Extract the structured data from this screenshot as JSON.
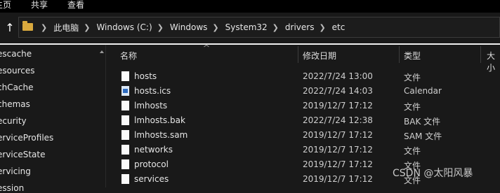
{
  "ribbon": {
    "tabs": [
      "主页",
      "共享",
      "查看"
    ]
  },
  "address": {
    "crumbs": [
      "此电脑",
      "Windows (C:)",
      "Windows",
      "System32",
      "drivers",
      "etc"
    ]
  },
  "nav": {
    "items": [
      "escache",
      "esources",
      "chCache",
      "chemas",
      "ecurity",
      "erviceProfiles",
      "erviceState",
      "ervicing",
      "ession"
    ]
  },
  "columns": {
    "name": "名称",
    "date": "修改日期",
    "type": "类型",
    "size": "大小"
  },
  "files": [
    {
      "name": "hosts",
      "date": "2022/7/24 13:00",
      "type": "文件",
      "icon": "file-icon"
    },
    {
      "name": "hosts.ics",
      "date": "2022/7/24 14:03",
      "type": "Calendar",
      "icon": "calendar-file-icon"
    },
    {
      "name": "lmhosts",
      "date": "2019/12/7 17:12",
      "type": "文件",
      "icon": "file-icon"
    },
    {
      "name": "lmhosts.bak",
      "date": "2022/7/24 12:38",
      "type": "BAK 文件",
      "icon": "file-icon"
    },
    {
      "name": "lmhosts.sam",
      "date": "2019/12/7 17:12",
      "type": "SAM 文件",
      "icon": "file-icon"
    },
    {
      "name": "networks",
      "date": "2019/12/7 17:12",
      "type": "文件",
      "icon": "file-icon"
    },
    {
      "name": "protocol",
      "date": "2019/12/7 17:12",
      "type": "文件",
      "icon": "file-icon"
    },
    {
      "name": "services",
      "date": "2019/12/7 17:12",
      "type": "文件",
      "icon": "file-icon"
    }
  ],
  "watermark": "CSDN @太阳风暴"
}
